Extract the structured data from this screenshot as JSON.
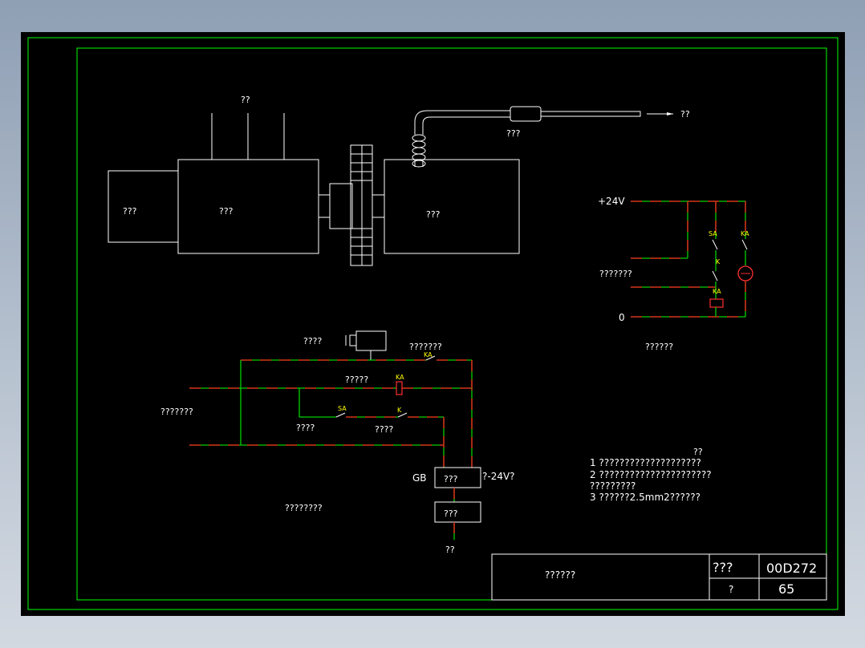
{
  "mechanical": {
    "top_label": "??",
    "box_left": "???",
    "box_mid": "???",
    "box_right": "???",
    "hose_label": "???",
    "arrow_label": "??"
  },
  "control_circuit": {
    "supply": "+24V",
    "zero": "0",
    "side_label": "???????",
    "caption": "??????",
    "sa": "SA",
    "ka": "KA",
    "k": "K"
  },
  "power_circuit": {
    "bell_label": "????",
    "contact_label": "???????",
    "relay_label": "?????",
    "input_label": "???????",
    "sa_label": "????",
    "k_label": "????",
    "gb": "GB",
    "box1": "???",
    "box1_note": "?-24V?",
    "box2": "???",
    "bottom_label": "??",
    "left_caption": "????????",
    "sa": "SA",
    "ka": "KA",
    "k": "K"
  },
  "notes": {
    "title": "??",
    "items": [
      "1  ????????????????????",
      "2  ??????????????????????",
      "    ?????????",
      "3  ??????2.5mm2??????"
    ]
  },
  "title_block": {
    "drawing_name": "??????",
    "code_label": "???",
    "code_value": "00D272",
    "page_label": "?",
    "page_value": "65"
  },
  "colors": {
    "sheet": "#000000",
    "frame": "#00ff00",
    "wire_green": "#00d000",
    "wire_red": "#ff2020",
    "symbol_label": "#ffff00"
  }
}
